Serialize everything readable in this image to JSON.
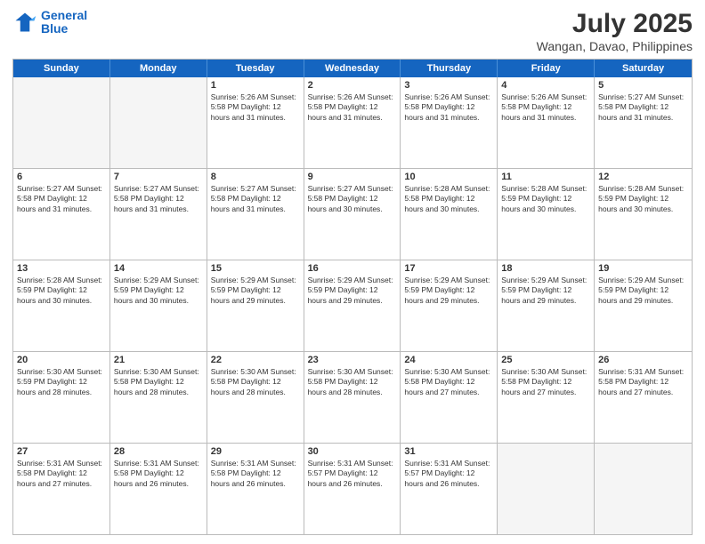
{
  "logo": {
    "line1": "General",
    "line2": "Blue"
  },
  "title": {
    "month_year": "July 2025",
    "location": "Wangan, Davao, Philippines"
  },
  "days_of_week": [
    "Sunday",
    "Monday",
    "Tuesday",
    "Wednesday",
    "Thursday",
    "Friday",
    "Saturday"
  ],
  "weeks": [
    [
      {
        "day": "",
        "info": ""
      },
      {
        "day": "",
        "info": ""
      },
      {
        "day": "1",
        "info": "Sunrise: 5:26 AM\nSunset: 5:58 PM\nDaylight: 12 hours and 31 minutes."
      },
      {
        "day": "2",
        "info": "Sunrise: 5:26 AM\nSunset: 5:58 PM\nDaylight: 12 hours and 31 minutes."
      },
      {
        "day": "3",
        "info": "Sunrise: 5:26 AM\nSunset: 5:58 PM\nDaylight: 12 hours and 31 minutes."
      },
      {
        "day": "4",
        "info": "Sunrise: 5:26 AM\nSunset: 5:58 PM\nDaylight: 12 hours and 31 minutes."
      },
      {
        "day": "5",
        "info": "Sunrise: 5:27 AM\nSunset: 5:58 PM\nDaylight: 12 hours and 31 minutes."
      }
    ],
    [
      {
        "day": "6",
        "info": "Sunrise: 5:27 AM\nSunset: 5:58 PM\nDaylight: 12 hours and 31 minutes."
      },
      {
        "day": "7",
        "info": "Sunrise: 5:27 AM\nSunset: 5:58 PM\nDaylight: 12 hours and 31 minutes."
      },
      {
        "day": "8",
        "info": "Sunrise: 5:27 AM\nSunset: 5:58 PM\nDaylight: 12 hours and 31 minutes."
      },
      {
        "day": "9",
        "info": "Sunrise: 5:27 AM\nSunset: 5:58 PM\nDaylight: 12 hours and 30 minutes."
      },
      {
        "day": "10",
        "info": "Sunrise: 5:28 AM\nSunset: 5:58 PM\nDaylight: 12 hours and 30 minutes."
      },
      {
        "day": "11",
        "info": "Sunrise: 5:28 AM\nSunset: 5:59 PM\nDaylight: 12 hours and 30 minutes."
      },
      {
        "day": "12",
        "info": "Sunrise: 5:28 AM\nSunset: 5:59 PM\nDaylight: 12 hours and 30 minutes."
      }
    ],
    [
      {
        "day": "13",
        "info": "Sunrise: 5:28 AM\nSunset: 5:59 PM\nDaylight: 12 hours and 30 minutes."
      },
      {
        "day": "14",
        "info": "Sunrise: 5:29 AM\nSunset: 5:59 PM\nDaylight: 12 hours and 30 minutes."
      },
      {
        "day": "15",
        "info": "Sunrise: 5:29 AM\nSunset: 5:59 PM\nDaylight: 12 hours and 29 minutes."
      },
      {
        "day": "16",
        "info": "Sunrise: 5:29 AM\nSunset: 5:59 PM\nDaylight: 12 hours and 29 minutes."
      },
      {
        "day": "17",
        "info": "Sunrise: 5:29 AM\nSunset: 5:59 PM\nDaylight: 12 hours and 29 minutes."
      },
      {
        "day": "18",
        "info": "Sunrise: 5:29 AM\nSunset: 5:59 PM\nDaylight: 12 hours and 29 minutes."
      },
      {
        "day": "19",
        "info": "Sunrise: 5:29 AM\nSunset: 5:59 PM\nDaylight: 12 hours and 29 minutes."
      }
    ],
    [
      {
        "day": "20",
        "info": "Sunrise: 5:30 AM\nSunset: 5:59 PM\nDaylight: 12 hours and 28 minutes."
      },
      {
        "day": "21",
        "info": "Sunrise: 5:30 AM\nSunset: 5:58 PM\nDaylight: 12 hours and 28 minutes."
      },
      {
        "day": "22",
        "info": "Sunrise: 5:30 AM\nSunset: 5:58 PM\nDaylight: 12 hours and 28 minutes."
      },
      {
        "day": "23",
        "info": "Sunrise: 5:30 AM\nSunset: 5:58 PM\nDaylight: 12 hours and 28 minutes."
      },
      {
        "day": "24",
        "info": "Sunrise: 5:30 AM\nSunset: 5:58 PM\nDaylight: 12 hours and 27 minutes."
      },
      {
        "day": "25",
        "info": "Sunrise: 5:30 AM\nSunset: 5:58 PM\nDaylight: 12 hours and 27 minutes."
      },
      {
        "day": "26",
        "info": "Sunrise: 5:31 AM\nSunset: 5:58 PM\nDaylight: 12 hours and 27 minutes."
      }
    ],
    [
      {
        "day": "27",
        "info": "Sunrise: 5:31 AM\nSunset: 5:58 PM\nDaylight: 12 hours and 27 minutes."
      },
      {
        "day": "28",
        "info": "Sunrise: 5:31 AM\nSunset: 5:58 PM\nDaylight: 12 hours and 26 minutes."
      },
      {
        "day": "29",
        "info": "Sunrise: 5:31 AM\nSunset: 5:58 PM\nDaylight: 12 hours and 26 minutes."
      },
      {
        "day": "30",
        "info": "Sunrise: 5:31 AM\nSunset: 5:57 PM\nDaylight: 12 hours and 26 minutes."
      },
      {
        "day": "31",
        "info": "Sunrise: 5:31 AM\nSunset: 5:57 PM\nDaylight: 12 hours and 26 minutes."
      },
      {
        "day": "",
        "info": ""
      },
      {
        "day": "",
        "info": ""
      }
    ]
  ]
}
